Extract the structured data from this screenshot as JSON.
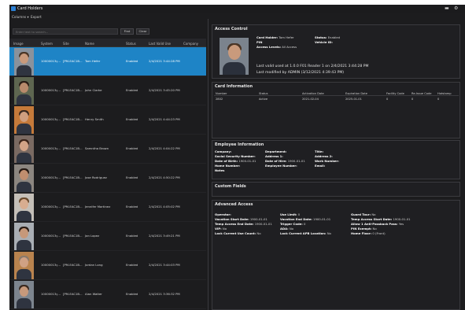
{
  "app": {
    "title": "Card Holders"
  },
  "window": {
    "minimize_glyph": "▬",
    "settings_glyph": "⚙"
  },
  "menu": {
    "columns": "Columns ▾",
    "export": "Export"
  },
  "toolbar": {
    "search_placeholder": "Enter text to search...",
    "find": "Find",
    "clear": "Clear"
  },
  "grid": {
    "columns": [
      "Image",
      "System",
      "Site",
      "Name",
      "Status",
      "Last Valid Use",
      "Company"
    ],
    "rows": [
      {
        "system": "10000013ç...",
        "site": "[PM-EAC1B...",
        "name": "Tom Hefer",
        "status": "Enabled",
        "last_use": "2/4/2021 3:44:28 PM",
        "selected": true,
        "skin": "#c99a7c",
        "hair": "#4a3526",
        "bg": "#8a929c"
      },
      {
        "system": "10000013ç...",
        "site": "[PM-EAC1B...",
        "name": "John Clarke",
        "status": "Enabled",
        "last_use": "2/4/2021 3:45:20 PM",
        "selected": false,
        "skin": "#b98a6c",
        "hair": "#2a1d16",
        "bg": "#5e6650"
      },
      {
        "system": "10000013ç...",
        "site": "[PM-EAC1B...",
        "name": "Henry Smith",
        "status": "Enabled",
        "last_use": "2/4/2021 4:44:23 PM",
        "selected": false,
        "skin": "#cf9f7f",
        "hair": "#3a2a20",
        "bg": "#c57a3a"
      },
      {
        "system": "10000013ç...",
        "site": "[PM-EAC1B...",
        "name": "Samntha Brown",
        "status": "Enabled",
        "last_use": "2/4/2021 4:04:22 PM",
        "selected": false,
        "skin": "#d3a487",
        "hair": "#3b2419",
        "bg": "#7a6a62"
      },
      {
        "system": "10000013ç...",
        "site": "[PM-EAC1B...",
        "name": "Jose Rodriguez",
        "status": "Enabled",
        "last_use": "2/4/2021 4:50:22 PM",
        "selected": false,
        "skin": "#c08e6f",
        "hair": "#241812",
        "bg": "#8c8680"
      },
      {
        "system": "10000013ç...",
        "site": "[PM-EAC1B...",
        "name": "Jennifer Martinez",
        "status": "Enabled",
        "last_use": "2/4/2021 4:05:02 PM",
        "selected": false,
        "skin": "#d8ad90",
        "hair": "#6a4a2c",
        "bg": "#c4bfb8"
      },
      {
        "system": "10000013ç...",
        "site": "[PM-EAC1B...",
        "name": "Jan Lopez",
        "status": "Enabled",
        "last_use": "2/4/2021 3:49:21 PM",
        "selected": false,
        "skin": "#c6987a",
        "hair": "#2a1d16",
        "bg": "#a9aeb4"
      },
      {
        "system": "10000013ç...",
        "site": "[PM-EAC1B...",
        "name": "Jordan Long",
        "status": "Enabled",
        "last_use": "2/4/2021 3:44:03 PM",
        "selected": false,
        "skin": "#d0a184",
        "hair": "#8a7a6c",
        "bg": "#b9834e"
      },
      {
        "system": "10000013ç...",
        "site": "[PM-EAC1B...",
        "name": "Alan Walter",
        "status": "Enabled",
        "last_use": "2/4/2021 3:36:32 PM",
        "selected": false,
        "skin": "#c7997b",
        "hair": "#3a2a20",
        "bg": "#7d858f"
      }
    ]
  },
  "access_control": {
    "title": "Access Control",
    "card_holder_label": "Card Holder:",
    "card_holder": "Tom Hefer",
    "pin_label": "PIN",
    "access_levels_label": "Access Levels:",
    "access_levels": "All Access",
    "status_label": "Status:",
    "status": "Enabled",
    "vehicle_id_label": "Vehicle ID:",
    "last_valid": "Last valid used at 1.0.0 F01 Reader 1 on 2/4/2021 3:44:28 PM",
    "last_modified": "Last modified by ADMIN (3/12/2021 4:39:43 PM)"
  },
  "card_information": {
    "title": "Card Information",
    "columns": [
      "Number",
      "Status",
      "Activation Date",
      "Expiration Date",
      "Facility Code",
      "Re-Issue Code",
      "Hotstamp"
    ],
    "rows": [
      [
        "2802",
        "Active",
        "2021-02-04",
        "2025-01-01",
        "0",
        "0",
        "0"
      ]
    ]
  },
  "employee_information": {
    "title": "Employee Information",
    "company": "Company:",
    "ssn": "Social Security Number:",
    "dob": "Date of Birth:",
    "dob_value": "1900-01-01",
    "home_number": "Home Number:",
    "notes": "Notes",
    "department": "Department:",
    "address1": "Address 1:",
    "doh": "Date of Hire:",
    "doh_value": "1900-01-01",
    "employee_number": "Employee Number:",
    "title_label": "Title:",
    "address2": "Address 2:",
    "work_number": "Work Number:",
    "email": "Email:"
  },
  "custom_fields": {
    "title": "Custom Fields"
  },
  "advanced_access": {
    "title": "Advanced Access",
    "operator": "Operator:",
    "vac_start": "Vacation Start Date:",
    "vac_start_v": "1900-01-01",
    "temp_end": "Temp Access End Date:",
    "temp_end_v": "1900-01-01",
    "vip": "VIP:",
    "vip_v": "No",
    "lock_use": "Lock Current Use Count:",
    "lock_use_v": "No",
    "use_limit": "Use Limit:",
    "use_limit_v": "0",
    "vac_end": "Vacation End Date:",
    "vac_end_v": "1900-01-01",
    "trigger": "Trigger Code:",
    "trigger_v": "0",
    "ada": "ADA:",
    "ada_v": "No",
    "lock_apb": "Lock Current APB Location:",
    "lock_apb_v": "No",
    "guard_tour": "Guard Tour:",
    "guard_tour_v": "No",
    "temp_start": "Temp Access Start Date:",
    "temp_start_v": "1900-01-01",
    "allow_pass": "Allow 1 Anti-Passback Pass:",
    "allow_pass_v": "Yes",
    "pin_exempt": "PIN Exempt:",
    "pin_exempt_v": "No",
    "home_floor": "Home Floor:",
    "home_floor_v": "0 (Front)"
  }
}
